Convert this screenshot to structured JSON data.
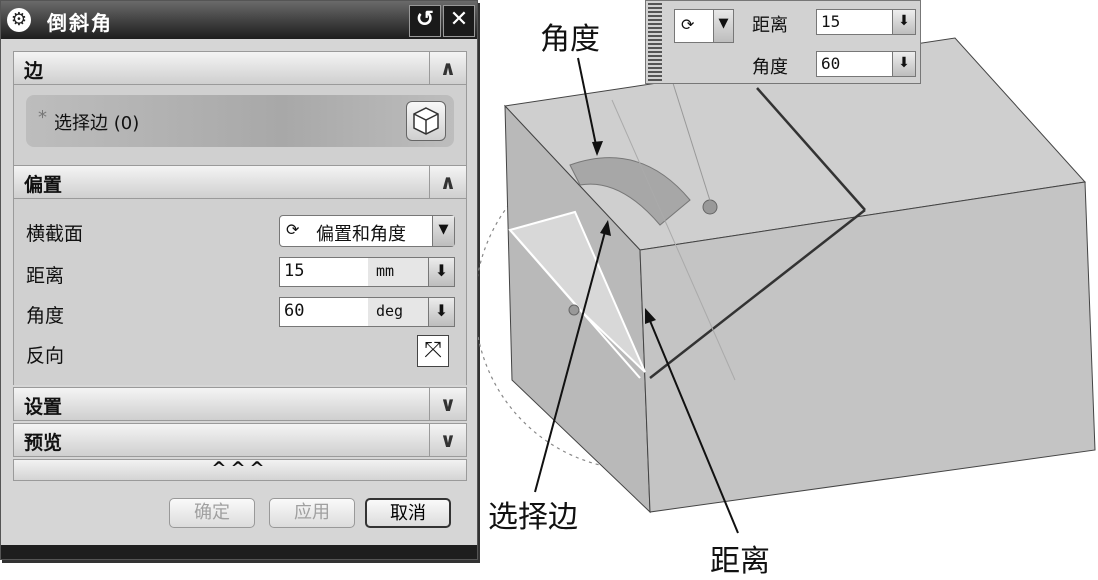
{
  "dialog": {
    "title": "倒斜角",
    "reset_icon": "reset-icon",
    "close_icon": "close-icon"
  },
  "edge_section": {
    "header": "边",
    "select_label": "选择边 (0)"
  },
  "offset_section": {
    "header": "偏置",
    "cross_section_label": "横截面",
    "cross_section_value": "偏置和角度",
    "distance_label": "距离",
    "distance_value": "15",
    "distance_unit": "mm",
    "angle_label": "角度",
    "angle_value": "60",
    "angle_unit": "deg",
    "reverse_label": "反向"
  },
  "settings_section": {
    "header": "设置"
  },
  "preview_section": {
    "header": "预览"
  },
  "expand_label": "^^^",
  "buttons": {
    "ok": "确定",
    "apply": "应用",
    "cancel": "取消"
  },
  "floating_toolbar": {
    "distance_label": "距离",
    "distance_value": "15",
    "angle_label": "角度",
    "angle_value": "60"
  },
  "annotations": {
    "angle": "角度",
    "select_edge": "选择边",
    "distance": "距离"
  },
  "colors": {
    "model_top": "#cfcfcf",
    "model_front": "#b9b9b9",
    "model_right": "#c4c4c4",
    "preview_band": "#a7a7a7"
  }
}
